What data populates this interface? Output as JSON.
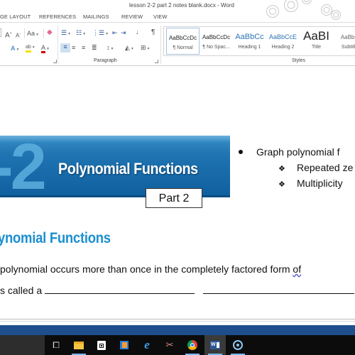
{
  "window": {
    "title": "lesson 2-2 part 2 notes blank.docx - Word"
  },
  "ribbon_tabs": [
    {
      "label": "GE LAYOUT"
    },
    {
      "label": "REFERENCES"
    },
    {
      "label": "MAILINGS"
    },
    {
      "label": "REVIEW"
    },
    {
      "label": "VIEW"
    }
  ],
  "ribbon": {
    "font_group": {
      "grow_font": "A",
      "shrink_font": "A",
      "change_case": "Aa",
      "text_effects": "A",
      "highlight": "ab",
      "font_color": "A",
      "font_color_hex": "#d00000",
      "highlight_hex": "#f2e300"
    },
    "paragraph_group": {
      "label": "Paragraph",
      "bullets_icon": "bullets-icon",
      "numbering_icon": "numbering-icon",
      "multilevel_icon": "multilevel-list-icon",
      "decrease_indent_icon": "decrease-indent-icon",
      "increase_indent_icon": "increase-indent-icon",
      "sort_icon": "sort-icon",
      "show_marks": "¶",
      "active_alignment": "align-left"
    },
    "styles_group": {
      "label": "Styles",
      "items": [
        {
          "sample": "AaBbCcDc",
          "name": "¶ Normal",
          "selected": true,
          "color": "#222222"
        },
        {
          "sample": "AaBbCcDc",
          "name": "¶ No Spac...",
          "selected": false,
          "color": "#222222"
        },
        {
          "sample": "AaBbCc",
          "name": "Heading 1",
          "selected": false,
          "color": "#2e74b5"
        },
        {
          "sample": "AaBbCcE",
          "name": "Heading 2",
          "selected": false,
          "color": "#2e74b5"
        },
        {
          "sample": "AaBI",
          "name": "Title",
          "selected": false,
          "color": "#222222"
        },
        {
          "sample": "AaBbC",
          "name": "Subtitle",
          "selected": false,
          "color": "#666666"
        }
      ]
    }
  },
  "document": {
    "banner": {
      "lesson_number": "-2",
      "title": "Polynomial Functions",
      "part_label": "Part 2"
    },
    "bullets": [
      {
        "level": 1,
        "text": "Graph polynomial f"
      },
      {
        "level": 2,
        "text": "Repeated ze"
      },
      {
        "level": 2,
        "text": "Multiplicity"
      }
    ],
    "section_heading": "ynomial Functions",
    "lines": [
      {
        "text": "polynomial occurs more than once in the completely factored form ",
        "tail": "of"
      },
      {
        "text": "s called a "
      }
    ],
    "accent_color": "#1c8fd0"
  },
  "taskbar": {
    "items": [
      {
        "name": "task-view",
        "glyph": "⧉",
        "active": false,
        "running": false
      },
      {
        "name": "file-explorer",
        "glyph": "▬",
        "active": false,
        "running": true
      },
      {
        "name": "store",
        "glyph": "⊞",
        "active": false,
        "running": false
      },
      {
        "name": "media-player",
        "glyph": "▶",
        "active": false,
        "running": false
      },
      {
        "name": "internet-explorer",
        "glyph": "e",
        "active": false,
        "running": false
      },
      {
        "name": "snipping-tool",
        "glyph": "✂",
        "active": false,
        "running": false
      },
      {
        "name": "chrome",
        "glyph": "◉",
        "active": false,
        "running": true
      },
      {
        "name": "word",
        "glyph": "W",
        "active": true,
        "running": true
      },
      {
        "name": "recorder",
        "glyph": "◎",
        "active": false,
        "running": true
      }
    ]
  }
}
